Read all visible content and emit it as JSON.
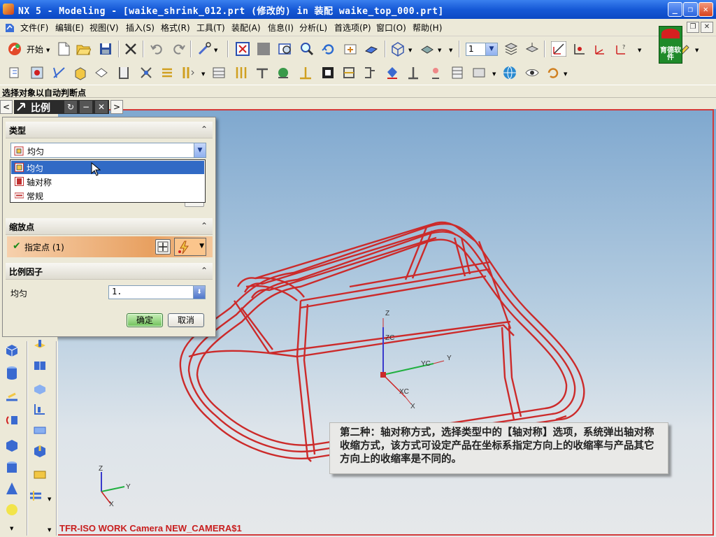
{
  "window": {
    "title": "NX 5 - Modeling - [waike_shrink_012.prt (修改的) in 装配 waike_top_000.prt]"
  },
  "menubar": {
    "items": [
      "文件(F)",
      "编辑(E)",
      "视图(V)",
      "插入(S)",
      "格式(R)",
      "工具(T)",
      "装配(A)",
      "信息(I)",
      "分析(L)",
      "首选项(P)",
      "窗口(O)",
      "帮助(H)"
    ],
    "brand_logo": "育德软件"
  },
  "toolbar1": {
    "start_label": "开始",
    "layer_value": "1"
  },
  "cue_line": "选择对象以自动判断点",
  "dialog": {
    "title": "比例",
    "type_section": {
      "label": "类型",
      "selected": "均匀",
      "options": [
        "均匀",
        "轴对称",
        "常规"
      ]
    },
    "scale_point_section": {
      "label": "缩放点",
      "specify_point": "指定点 (1)"
    },
    "scale_factor_section": {
      "label": "比例因子",
      "uniform_label": "均匀",
      "uniform_value": "1."
    },
    "ok_label": "确定",
    "cancel_label": "取消"
  },
  "viewport": {
    "wcs_labels": {
      "z": "Z",
      "zc": "ZC",
      "y": "Y",
      "yc": "YC",
      "x": "X",
      "xc": "XC"
    },
    "triad_labels": {
      "z": "Z",
      "y": "Y",
      "x": "X"
    },
    "camera_label": "TFR-ISO WORK Camera NEW_CAMERA$1",
    "callout_text": "第二种：轴对称方式，选择类型中的【轴对称】选项，系统弹出轴对称收缩方式，该方式可设定产品在坐标系指定方向上的收缩率与产品其它方向上的收缩率是不同的。"
  },
  "colors": {
    "model_wire": "#cc2a2a",
    "title_blue": "#1659d6",
    "selection_blue": "#316ac5",
    "point_orange": "#e8a060"
  }
}
